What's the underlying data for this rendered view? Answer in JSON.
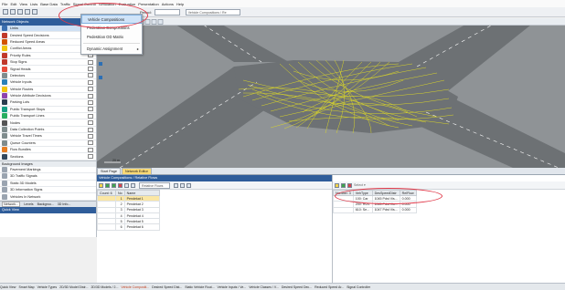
{
  "menu": [
    "File",
    "Edit",
    "View",
    "Lists",
    "Base Data",
    "Traffic",
    "Signal Control",
    "Simulation",
    "Evaluation",
    "Presentation",
    "Actions",
    "Help"
  ],
  "toolbar": {
    "period_label": "Period:",
    "period_value": "",
    "list_label": "Vehicle Compositions / Re"
  },
  "dropdown": {
    "items": [
      "Vehicle Compositions",
      "Pedestrian Compositions",
      "Pedestrian OD Matrix",
      "Dynamic Assignment"
    ],
    "submenu_arrow": "▸"
  },
  "left_panel": {
    "title": "Network Objects",
    "objects": [
      {
        "label": "Links",
        "color": "#3b6fb0"
      },
      {
        "label": "Desired Speed Decisions",
        "color": "#c0392b"
      },
      {
        "label": "Reduced Speed Areas",
        "color": "#d35400"
      },
      {
        "label": "Conflict Areas",
        "color": "#f1c40f"
      },
      {
        "label": "Priority Rules",
        "color": "#c0392b"
      },
      {
        "label": "Stop Signs",
        "color": "#c0392b"
      },
      {
        "label": "Signal Heads",
        "color": "#e74c3c"
      },
      {
        "label": "Detectors",
        "color": "#7f8c8d"
      },
      {
        "label": "Vehicle Inputs",
        "color": "#2980b9"
      },
      {
        "label": "Vehicle Routes",
        "color": "#f1c40f"
      },
      {
        "label": "Vehicle Attribute Decisions",
        "color": "#8e44ad"
      },
      {
        "label": "Parking Lots",
        "color": "#2c3e50"
      },
      {
        "label": "Public Transport Stops",
        "color": "#16a085"
      },
      {
        "label": "Public Transport Lines",
        "color": "#27ae60"
      },
      {
        "label": "Nodes",
        "color": "#555555"
      },
      {
        "label": "Data Collection Points",
        "color": "#7f8c8d"
      },
      {
        "label": "Vehicle Travel Times",
        "color": "#7f8c8d"
      },
      {
        "label": "Queue Counters",
        "color": "#7f8c8d"
      },
      {
        "label": "Flow Bundles",
        "color": "#e67e22"
      },
      {
        "label": "Sections",
        "color": "#34495e"
      }
    ],
    "bg_title": "Background Images",
    "bg_items": [
      {
        "label": "Pavement Markings"
      },
      {
        "label": "3D Traffic Signals"
      },
      {
        "label": "Static 3D Models"
      },
      {
        "label": "3D Information Signs"
      },
      {
        "label": "Vehicles In Network"
      }
    ],
    "tabs": [
      "Network...",
      "Levels",
      "Backgrou...",
      "3D Info..."
    ],
    "quick_view_title": "Quick View"
  },
  "editor": {
    "scale": "20 m",
    "tabs": [
      "Start Page",
      "Network Editor"
    ]
  },
  "vc_pane": {
    "title": "Vehicle Compositions / Relative Flows",
    "select_label": "Relative Flows",
    "columns": [
      "Count: 6",
      "No",
      "Name"
    ],
    "rows": [
      {
        "no": "1",
        "name": "Pendekat 1"
      },
      {
        "no": "2",
        "name": "Pendekat 2"
      },
      {
        "no": "3",
        "name": "Pendekat 3"
      },
      {
        "no": "4",
        "name": "Pendekat 4"
      },
      {
        "no": "5",
        "name": "Pendekat 5"
      },
      {
        "no": "6",
        "name": "Pendekat 6"
      }
    ]
  },
  "rf_pane": {
    "select_label": "Select ▾",
    "columns": [
      "Number: 3",
      "VehType",
      "DesSpeedDistr",
      "RelFlow"
    ],
    "rows": [
      {
        "vt": "100: Car",
        "ds": "1045 Pdst Vis...",
        "rf": "0.000"
      },
      {
        "vt": "200: HGV",
        "ds": "1045 Pdst Vis...",
        "rf": "0.000"
      },
      {
        "vt": "610: Se...",
        "ds": "1047 Pdst Vis...",
        "rf": "0.000"
      }
    ]
  },
  "statusbar": [
    "Quick View",
    "Smart Map",
    "Vehicle Types",
    "2D/3D Model Distr...",
    "2D/3D Models / 2...",
    "Vehicle Compositi...",
    "Desired Speed Dist...",
    "Static Vehicle Rout...",
    "Vehicle Inputs / Ve...",
    "Vehicle Classes / V...",
    "Desired Speed Dec...",
    "Reduced Speed Ar...",
    "Signal Controller"
  ],
  "colors": {
    "accent": "#2f5d9a",
    "highlight": "#e03a4a",
    "selected_row": "#fbe7a5"
  }
}
